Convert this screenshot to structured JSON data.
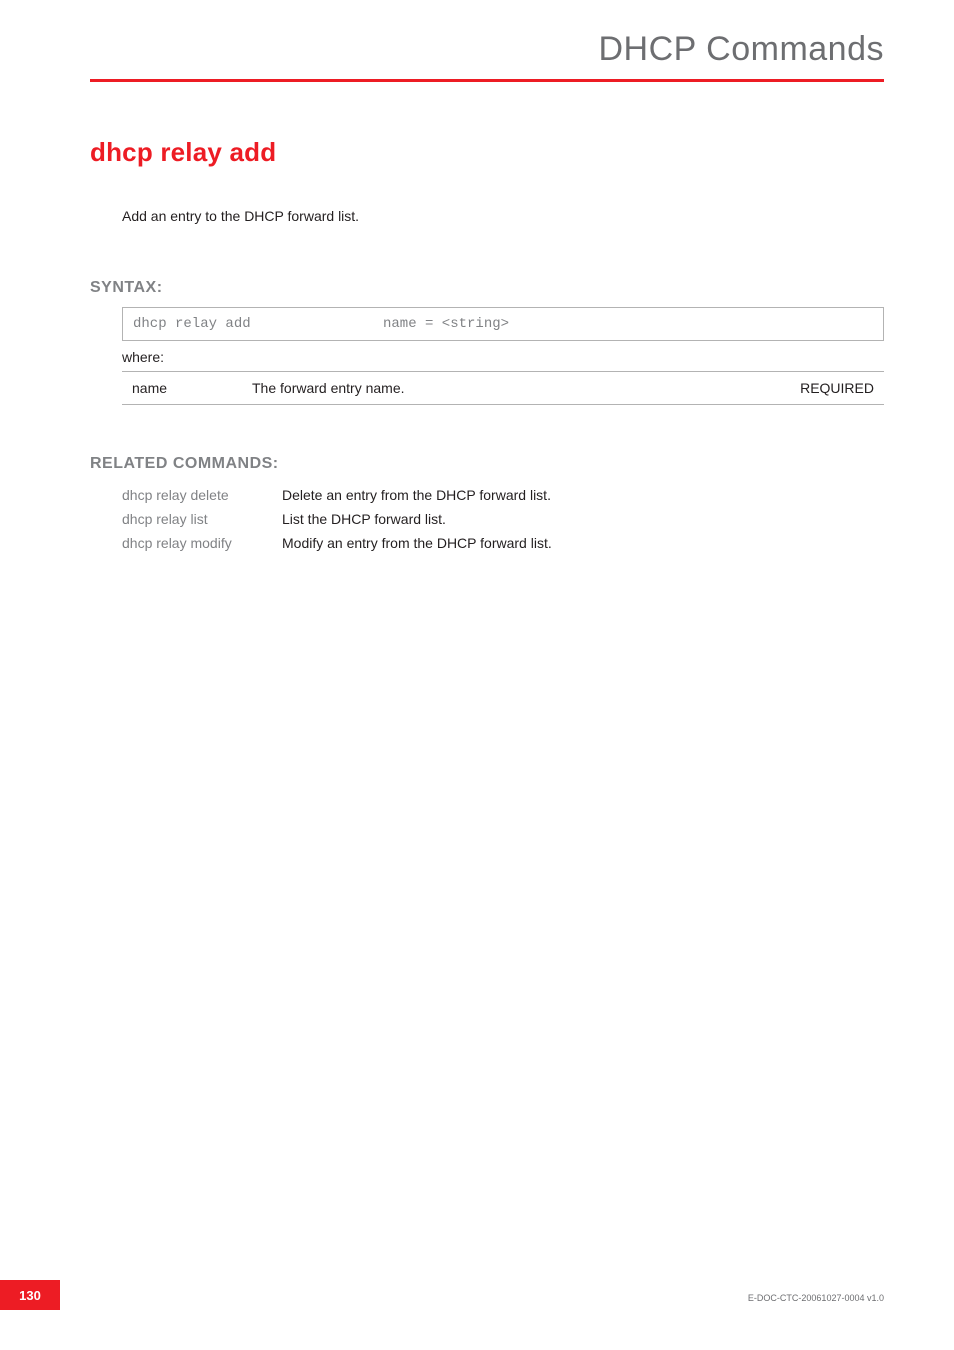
{
  "header": {
    "running_title": "DHCP Commands"
  },
  "command": {
    "title": "dhcp relay add",
    "intro": "Add an entry to the DHCP forward list."
  },
  "syntax": {
    "label": "SYNTAX:",
    "cmd": "dhcp relay add",
    "args": "name = <string>",
    "where": "where:",
    "params": [
      {
        "name": "name",
        "desc": "The forward entry name.",
        "req": "REQUIRED"
      }
    ]
  },
  "related": {
    "label": "RELATED COMMANDS:",
    "rows": [
      {
        "cmd": "dhcp relay delete",
        "desc": "Delete an entry from the DHCP forward list."
      },
      {
        "cmd": "dhcp relay list",
        "desc": "List the DHCP forward list."
      },
      {
        "cmd": "dhcp relay modify",
        "desc": "Modify an entry from the DHCP forward list."
      }
    ]
  },
  "footer": {
    "page": "130",
    "docid": "E-DOC-CTC-20061027-0004 v1.0"
  }
}
